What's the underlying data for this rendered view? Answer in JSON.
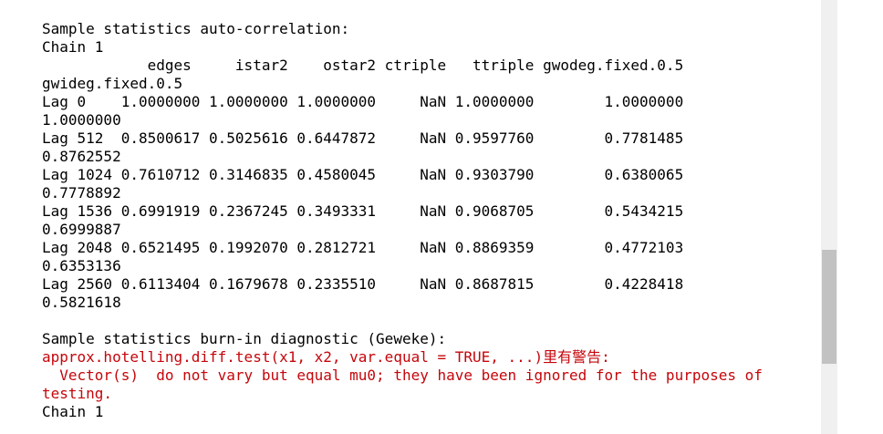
{
  "console": {
    "lines": [
      {
        "text": "Sample statistics auto-correlation:",
        "kind": "output"
      },
      {
        "text": "Chain 1",
        "kind": "output"
      },
      {
        "text": "            edges     istar2    ostar2 ctriple   ttriple gwodeg.fixed.0.5",
        "kind": "output"
      },
      {
        "text": "gwideg.fixed.0.5",
        "kind": "output"
      },
      {
        "text": "Lag 0    1.0000000 1.0000000 1.0000000     NaN 1.0000000        1.0000000",
        "kind": "output"
      },
      {
        "text": "1.0000000",
        "kind": "output"
      },
      {
        "text": "Lag 512  0.8500617 0.5025616 0.6447872     NaN 0.9597760        0.7781485",
        "kind": "output"
      },
      {
        "text": "0.8762552",
        "kind": "output"
      },
      {
        "text": "Lag 1024 0.7610712 0.3146835 0.4580045     NaN 0.9303790        0.6380065",
        "kind": "output"
      },
      {
        "text": "0.7778892",
        "kind": "output"
      },
      {
        "text": "Lag 1536 0.6991919 0.2367245 0.3493331     NaN 0.9068705        0.5434215",
        "kind": "output"
      },
      {
        "text": "0.6999887",
        "kind": "output"
      },
      {
        "text": "Lag 2048 0.6521495 0.1992070 0.2812721     NaN 0.8869359        0.4772103",
        "kind": "output"
      },
      {
        "text": "0.6353136",
        "kind": "output"
      },
      {
        "text": "Lag 2560 0.6113404 0.1679678 0.2335510     NaN 0.8687815        0.4228418",
        "kind": "output"
      },
      {
        "text": "0.5821618",
        "kind": "output"
      },
      {
        "text": "",
        "kind": "output"
      },
      {
        "text": "Sample statistics burn-in diagnostic (Geweke):",
        "kind": "output"
      },
      {
        "text": "approx.hotelling.diff.test(x1, x2, var.equal = TRUE, ...)里有警告:",
        "kind": "warning"
      },
      {
        "text": "  Vector(s)  do not vary but equal mu0; they have been ignored for the purposes of",
        "kind": "warning"
      },
      {
        "text": "testing.",
        "kind": "warning"
      },
      {
        "text": "Chain 1",
        "kind": "output"
      }
    ]
  },
  "scrollbar": {
    "position_fraction": 0.58
  },
  "colors": {
    "output_text": "#000000",
    "warning_text": "#c5060b",
    "scroll_track": "#f0f0f0",
    "scroll_thumb": "#c2c2c2"
  }
}
